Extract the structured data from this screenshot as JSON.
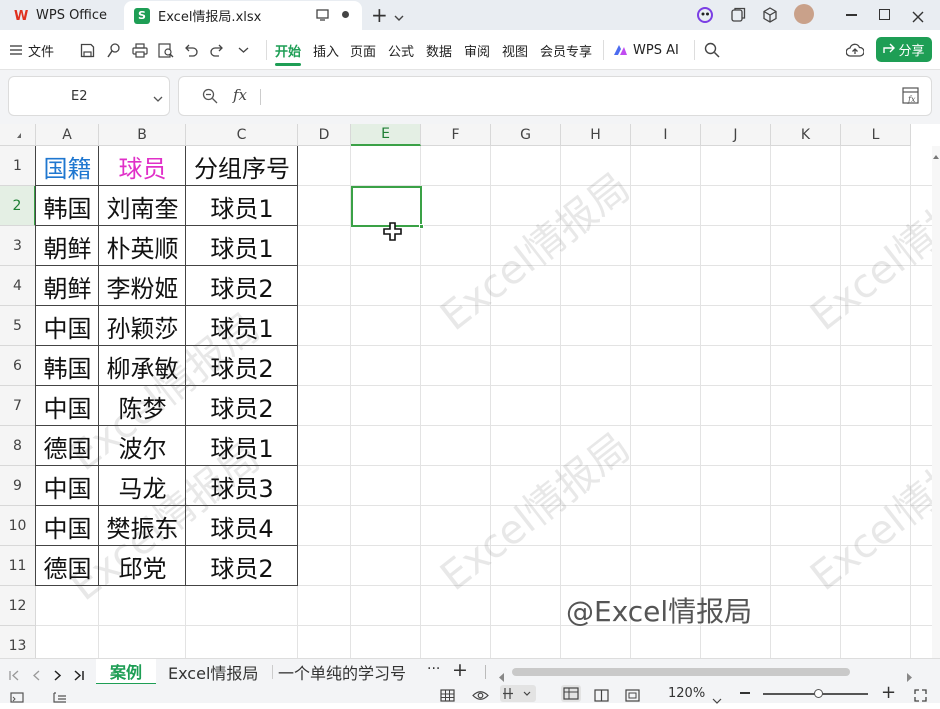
{
  "titlebar": {
    "app_tab": "WPS Office",
    "file_tab": "Excel情报局.xlsx",
    "app_logo": "W",
    "file_logo": "S"
  },
  "menu": {
    "file": "文件",
    "ribbon_tabs": [
      "开始",
      "插入",
      "页面",
      "公式",
      "数据",
      "审阅",
      "视图",
      "会员专享"
    ],
    "wps_ai": "WPS AI",
    "share": "分享"
  },
  "formula_bar": {
    "cell_ref": "E2",
    "fx": "fx",
    "content": ""
  },
  "columns": [
    "A",
    "B",
    "C",
    "D",
    "E",
    "F",
    "G",
    "H",
    "I",
    "J",
    "K",
    "L"
  ],
  "rows": [
    "1",
    "2",
    "3",
    "4",
    "5",
    "6",
    "7",
    "8",
    "9",
    "10",
    "11",
    "12",
    "13"
  ],
  "table": {
    "headers": [
      "国籍",
      "球员",
      "分组序号"
    ],
    "header_colors": [
      "#1f77d0",
      "#e030c8",
      "#111111"
    ],
    "data": [
      [
        "韩国",
        "刘南奎",
        "球员1"
      ],
      [
        "朝鲜",
        "朴英顺",
        "球员1"
      ],
      [
        "朝鲜",
        "李粉姬",
        "球员2"
      ],
      [
        "中国",
        "孙颖莎",
        "球员1"
      ],
      [
        "韩国",
        "柳承敏",
        "球员2"
      ],
      [
        "中国",
        "陈梦",
        "球员2"
      ],
      [
        "德国",
        "波尔",
        "球员1"
      ],
      [
        "中国",
        "马龙",
        "球员3"
      ],
      [
        "中国",
        "樊振东",
        "球员4"
      ],
      [
        "德国",
        "邱党",
        "球员2"
      ]
    ]
  },
  "watermark_text": "Excel情报局",
  "signature": "@Excel情报局",
  "sheets": {
    "tabs": [
      "案例",
      "Excel情报局",
      "一个单纯的学习号"
    ],
    "more": "···",
    "add": "+"
  },
  "status": {
    "zoom": "120%"
  },
  "colors": {
    "accent_green": "#1e9e55",
    "selection": "#3aa146"
  }
}
